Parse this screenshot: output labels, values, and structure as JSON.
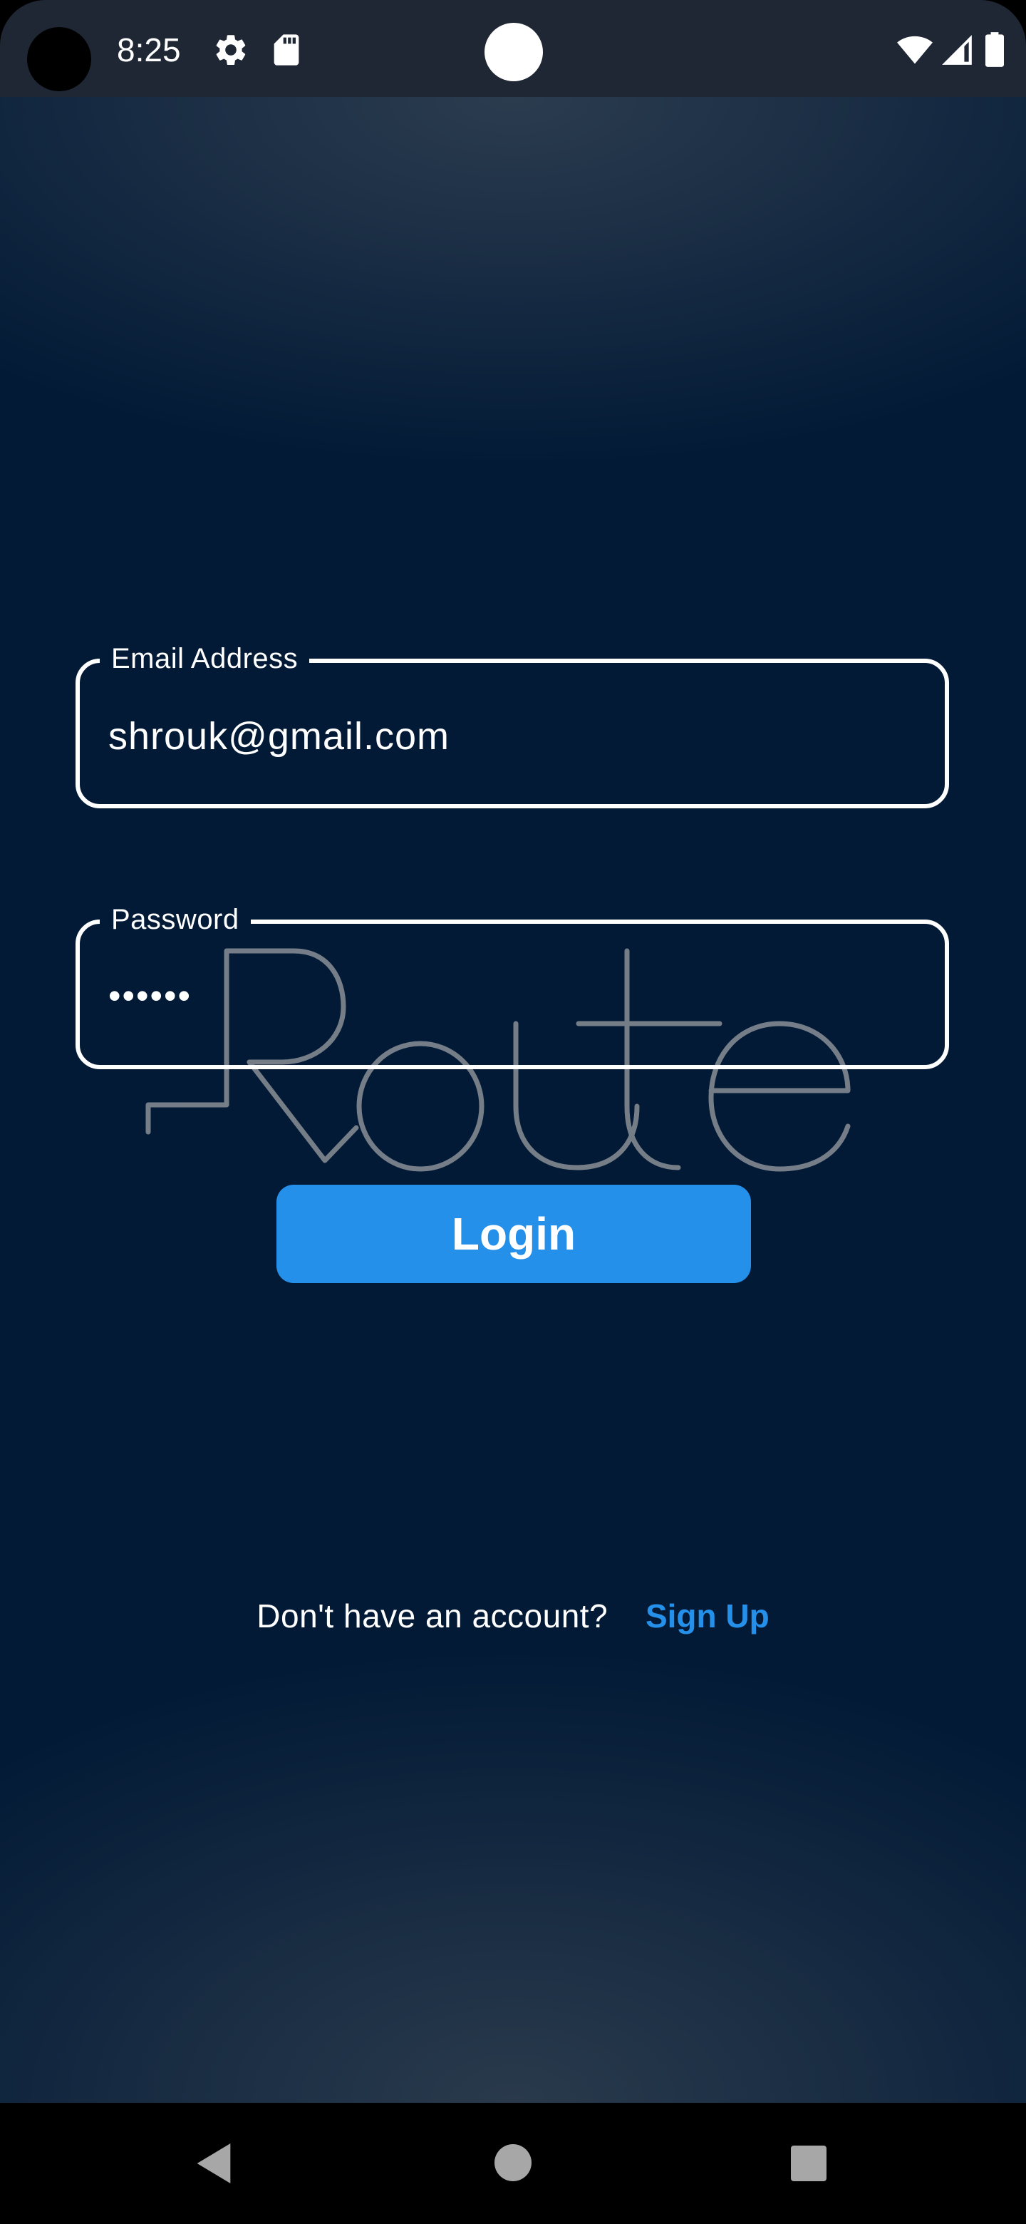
{
  "status_bar": {
    "time": "8:25",
    "icons": [
      "settings-icon",
      "sd-card-icon",
      "wifi-icon",
      "signal-icon",
      "battery-icon"
    ]
  },
  "login_form": {
    "email": {
      "label": "Email Address",
      "value": "shrouk@gmail.com"
    },
    "password": {
      "label": "Password",
      "value": "••••••"
    },
    "login_button": "Login"
  },
  "logo": {
    "text": "Route"
  },
  "signup": {
    "prompt": "Don't have an account?",
    "link": "Sign Up"
  },
  "nav_bar": {
    "icons": [
      "back-icon",
      "home-icon",
      "recents-icon"
    ]
  },
  "colors": {
    "background": "#021a36",
    "accent": "#2590ea",
    "field_border": "#ffffff",
    "status_bar": "#1e2733"
  }
}
